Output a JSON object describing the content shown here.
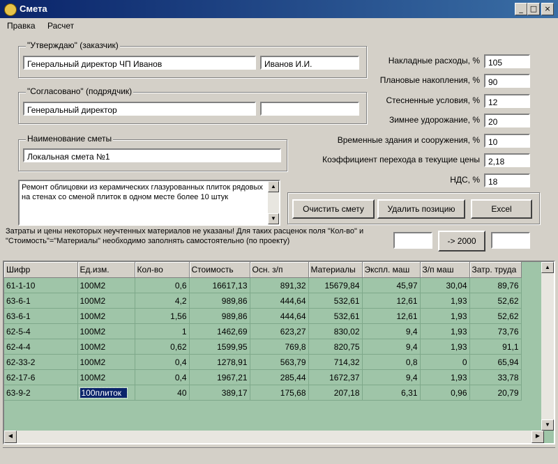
{
  "window": {
    "title": "Смета",
    "minimize": "_",
    "maximize": "□",
    "close": "×"
  },
  "menu": [
    "Правка",
    "Расчет"
  ],
  "approve": {
    "legend": "\"Утверждаю\" (заказчик)",
    "position": "Генеральный директор ЧП Иванов",
    "name": "Иванов И.И."
  },
  "agree": {
    "legend": "\"Согласовано\" (подрядчик)",
    "position": "Генеральный директор",
    "name": ""
  },
  "estimate": {
    "legend": "Наименование сметы",
    "value": "Локальная смета №1"
  },
  "description": "Ремонт облицовки из керамических глазурованных плиток рядовых на стенах со сменой плиток в одном месте более 10 штук",
  "params": [
    {
      "label": "Накладные расходы, %",
      "value": "105"
    },
    {
      "label": "Плановые накопления, %",
      "value": "90"
    },
    {
      "label": "Стесненные условия, %",
      "value": "12"
    },
    {
      "label": "Зимнее удорожание, %",
      "value": "20"
    },
    {
      "label": "Временные здания и сооружения, %",
      "value": "10"
    },
    {
      "label": "Коэффициент перехода в текущие цены",
      "value": "2,18"
    },
    {
      "label": "НДС, %",
      "value": "18"
    }
  ],
  "buttons": {
    "clear": "Очистить смету",
    "delete": "Удалить позицию",
    "excel": "Excel",
    "convert": "-> 2000"
  },
  "info_text": "Затраты и цены некоторых неучтенных материалов не указаны! Для таких расценок поля \"Кол-во\" и \"Стоимость\"=\"Материалы\" необходимо заполнять самостоятельно (по проекту)",
  "convert_from": "",
  "convert_to": "",
  "table": {
    "columns": [
      "Шифр",
      "Ед.изм.",
      "Кол-во",
      "Стоимость",
      "Осн. з/п",
      "Материалы",
      "Экспл. маш",
      "З/п маш",
      "Затр. труда"
    ],
    "rows": [
      [
        "61-1-10",
        "100М2",
        "0,6",
        "16617,13",
        "891,32",
        "15679,84",
        "45,97",
        "30,04",
        "89,76"
      ],
      [
        "63-6-1",
        "100М2",
        "4,2",
        "989,86",
        "444,64",
        "532,61",
        "12,61",
        "1,93",
        "52,62"
      ],
      [
        "63-6-1",
        "100М2",
        "1,56",
        "989,86",
        "444,64",
        "532,61",
        "12,61",
        "1,93",
        "52,62"
      ],
      [
        "62-5-4",
        "100М2",
        "1",
        "1462,69",
        "623,27",
        "830,02",
        "9,4",
        "1,93",
        "73,76"
      ],
      [
        "62-4-4",
        "100М2",
        "0,62",
        "1599,95",
        "769,8",
        "820,75",
        "9,4",
        "1,93",
        "91,1"
      ],
      [
        "62-33-2",
        "100М2",
        "0,4",
        "1278,91",
        "563,79",
        "714,32",
        "0,8",
        "0",
        "65,94"
      ],
      [
        "62-17-6",
        "100М2",
        "0,4",
        "1967,21",
        "285,44",
        "1672,37",
        "9,4",
        "1,93",
        "33,78"
      ],
      [
        "63-9-2",
        "100плиток",
        "40",
        "389,17",
        "175,68",
        "207,18",
        "6,31",
        "0,96",
        "20,79"
      ]
    ]
  },
  "colors": {
    "title": "#0a246a",
    "grid_bg": "#9fc5a8",
    "selection": "#0a246a"
  }
}
